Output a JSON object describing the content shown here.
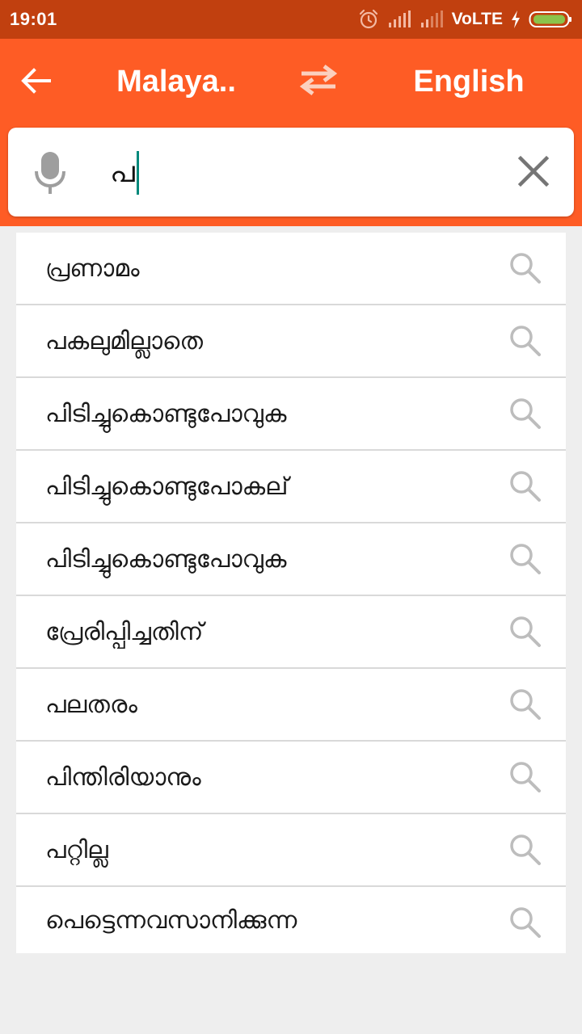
{
  "status_bar": {
    "time": "19:01",
    "network_label": "VoLTE",
    "icons": [
      "alarm-icon",
      "signal-icon",
      "signal-icon",
      "charging-icon",
      "battery-icon"
    ]
  },
  "toolbar": {
    "source_language": "Malaya..",
    "target_language": "English",
    "back_icon": "arrow-left-icon",
    "swap_icon": "swap-arrows-icon"
  },
  "search": {
    "query": "പ",
    "mic_icon": "microphone-icon",
    "clear_icon": "close-icon"
  },
  "suggestions": [
    {
      "text": "പ്രണാമം"
    },
    {
      "text": "പകലുമില്ലാതെ"
    },
    {
      "text": "പിടിച്ചുകൊണ്ടുപോവുക"
    },
    {
      "text": "പിടിച്ചുകൊണ്ടുപോകല്"
    },
    {
      "text": "പിടിച്ചുകൊണ്ടുപോവുക"
    },
    {
      "text": "പ്രേരിപ്പിച്ചതിന്"
    },
    {
      "text": "പലതരം"
    },
    {
      "text": "പിന്തിരിയാനും"
    },
    {
      "text": "പറ്റില്ല"
    },
    {
      "text": "പെട്ടെന്നവസാനിക്കുന്ന"
    }
  ],
  "colors": {
    "status_bar": "#c1400f",
    "app_bar": "#fe5c25",
    "caret": "#00897b",
    "icon_grey": "#9e9e9e"
  }
}
